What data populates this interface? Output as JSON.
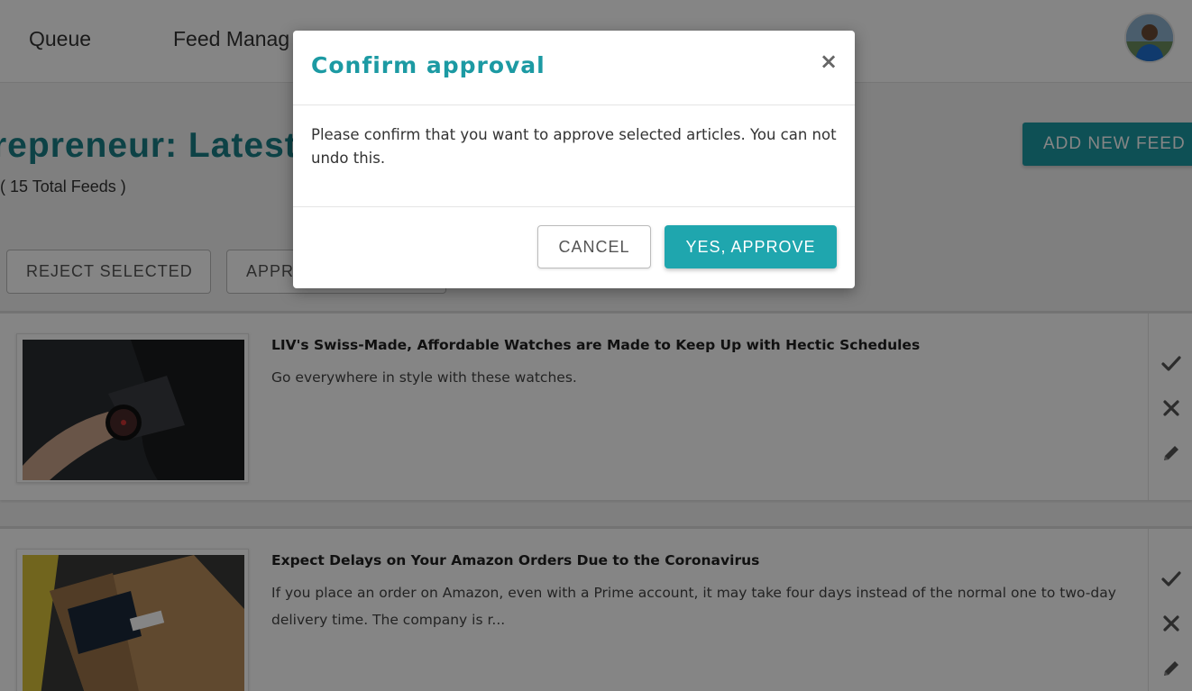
{
  "nav": {
    "items": [
      {
        "label": "Queue"
      },
      {
        "label": "Feed Manag"
      }
    ]
  },
  "page": {
    "title": "repreneur: Latest A",
    "feed_count": "( 15 Total Feeds )",
    "add_feed_label": "ADD NEW FEED"
  },
  "bulk_actions": {
    "reject_label": "REJECT SELECTED",
    "approve_label": "APPR"
  },
  "articles": [
    {
      "title": "LIV's Swiss-Made, Affordable Watches are Made to Keep Up with Hectic Schedules",
      "description": "Go everywhere in style with these watches.",
      "image_icon": "wristwatch-photo"
    },
    {
      "title": "Expect Delays on Your Amazon Orders Due to the Coronavirus",
      "description": "If you place an order on Amazon, even with a Prime account, it may take four days instead of the normal one to two-day delivery time. The company is r...",
      "image_icon": "amazon-box-photo"
    }
  ],
  "modal": {
    "title": "Confirm approval",
    "close_glyph": "×",
    "body": "Please confirm that you want to approve selected articles. You can not undo this.",
    "cancel_label": "CANCEL",
    "confirm_label": "YES, APPROVE"
  },
  "colors": {
    "accent": "#1c9aa3",
    "overlay": "rgba(0,0,0,0.48)"
  }
}
